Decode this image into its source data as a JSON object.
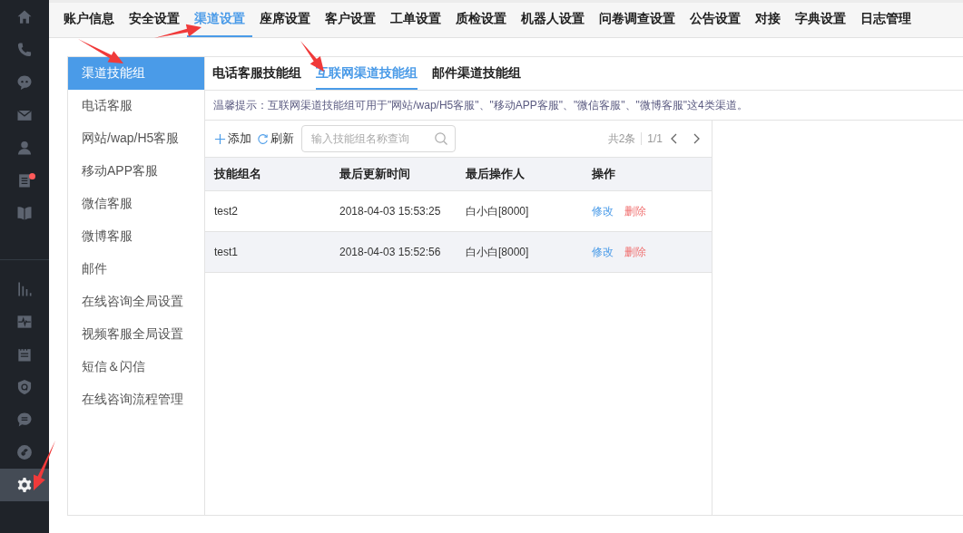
{
  "nav_rail": [
    {
      "selected": false,
      "badge": false
    },
    {
      "selected": false,
      "badge": false
    },
    {
      "selected": false,
      "badge": false
    },
    {
      "selected": false,
      "badge": false
    },
    {
      "selected": false,
      "badge": false
    },
    {
      "selected": false,
      "badge": true
    },
    {
      "selected": false,
      "badge": false
    },
    {
      "selected": false,
      "badge": false
    },
    {
      "selected": false,
      "badge": false
    },
    {
      "selected": false,
      "badge": false
    },
    {
      "selected": false,
      "badge": false
    },
    {
      "selected": false,
      "badge": false
    },
    {
      "selected": false,
      "badge": false
    },
    {
      "selected": true,
      "badge": false
    }
  ],
  "top_tabs": [
    {
      "label": "账户信息",
      "selected": false
    },
    {
      "label": "安全设置",
      "selected": false
    },
    {
      "label": "渠道设置",
      "selected": true
    },
    {
      "label": "座席设置",
      "selected": false
    },
    {
      "label": "客户设置",
      "selected": false
    },
    {
      "label": "工单设置",
      "selected": false
    },
    {
      "label": "质检设置",
      "selected": false
    },
    {
      "label": "机器人设置",
      "selected": false
    },
    {
      "label": "问卷调查设置",
      "selected": false
    },
    {
      "label": "公告设置",
      "selected": false
    },
    {
      "label": "对接",
      "selected": false
    },
    {
      "label": "字典设置",
      "selected": false
    },
    {
      "label": "日志管理",
      "selected": false
    }
  ],
  "side_menu": [
    {
      "label": "渠道技能组",
      "selected": true
    },
    {
      "label": "电话客服",
      "selected": false
    },
    {
      "label": "网站/wap/H5客服",
      "selected": false
    },
    {
      "label": "移动APP客服",
      "selected": false
    },
    {
      "label": "微信客服",
      "selected": false
    },
    {
      "label": "微博客服",
      "selected": false
    },
    {
      "label": "邮件",
      "selected": false
    },
    {
      "label": "在线咨询全局设置",
      "selected": false
    },
    {
      "label": "视频客服全局设置",
      "selected": false
    },
    {
      "label": "短信＆闪信",
      "selected": false
    },
    {
      "label": "在线咨询流程管理",
      "selected": false
    }
  ],
  "sub_tabs": [
    {
      "label": "电话客服技能组",
      "selected": false
    },
    {
      "label": "互联网渠道技能组",
      "selected": true
    },
    {
      "label": "邮件渠道技能组",
      "selected": false
    }
  ],
  "hint": "温馨提示：互联网渠道技能组可用于\"网站/wap/H5客服\"、\"移动APP客服\"、\"微信客服\"、\"微博客服\"这4类渠道。",
  "toolbar": {
    "add": "添加",
    "refresh": "刷新",
    "search": {
      "placeholder": "输入技能组名称查询"
    },
    "total": "共2条",
    "page": "1/1"
  },
  "table": {
    "columns": [
      "技能组名",
      "最后更新时间",
      "最后操作人",
      "操作"
    ],
    "rows": [
      {
        "cells": [
          "test2",
          "2018-04-03 15:53:25",
          "白小白[8000]"
        ],
        "actions": [
          "修改",
          "删除"
        ],
        "hovered": false
      },
      {
        "cells": [
          "test1",
          "2018-04-03 15:52:56",
          "白小白[8000]"
        ],
        "actions": [
          "修改",
          "删除"
        ],
        "hovered": true
      }
    ]
  }
}
